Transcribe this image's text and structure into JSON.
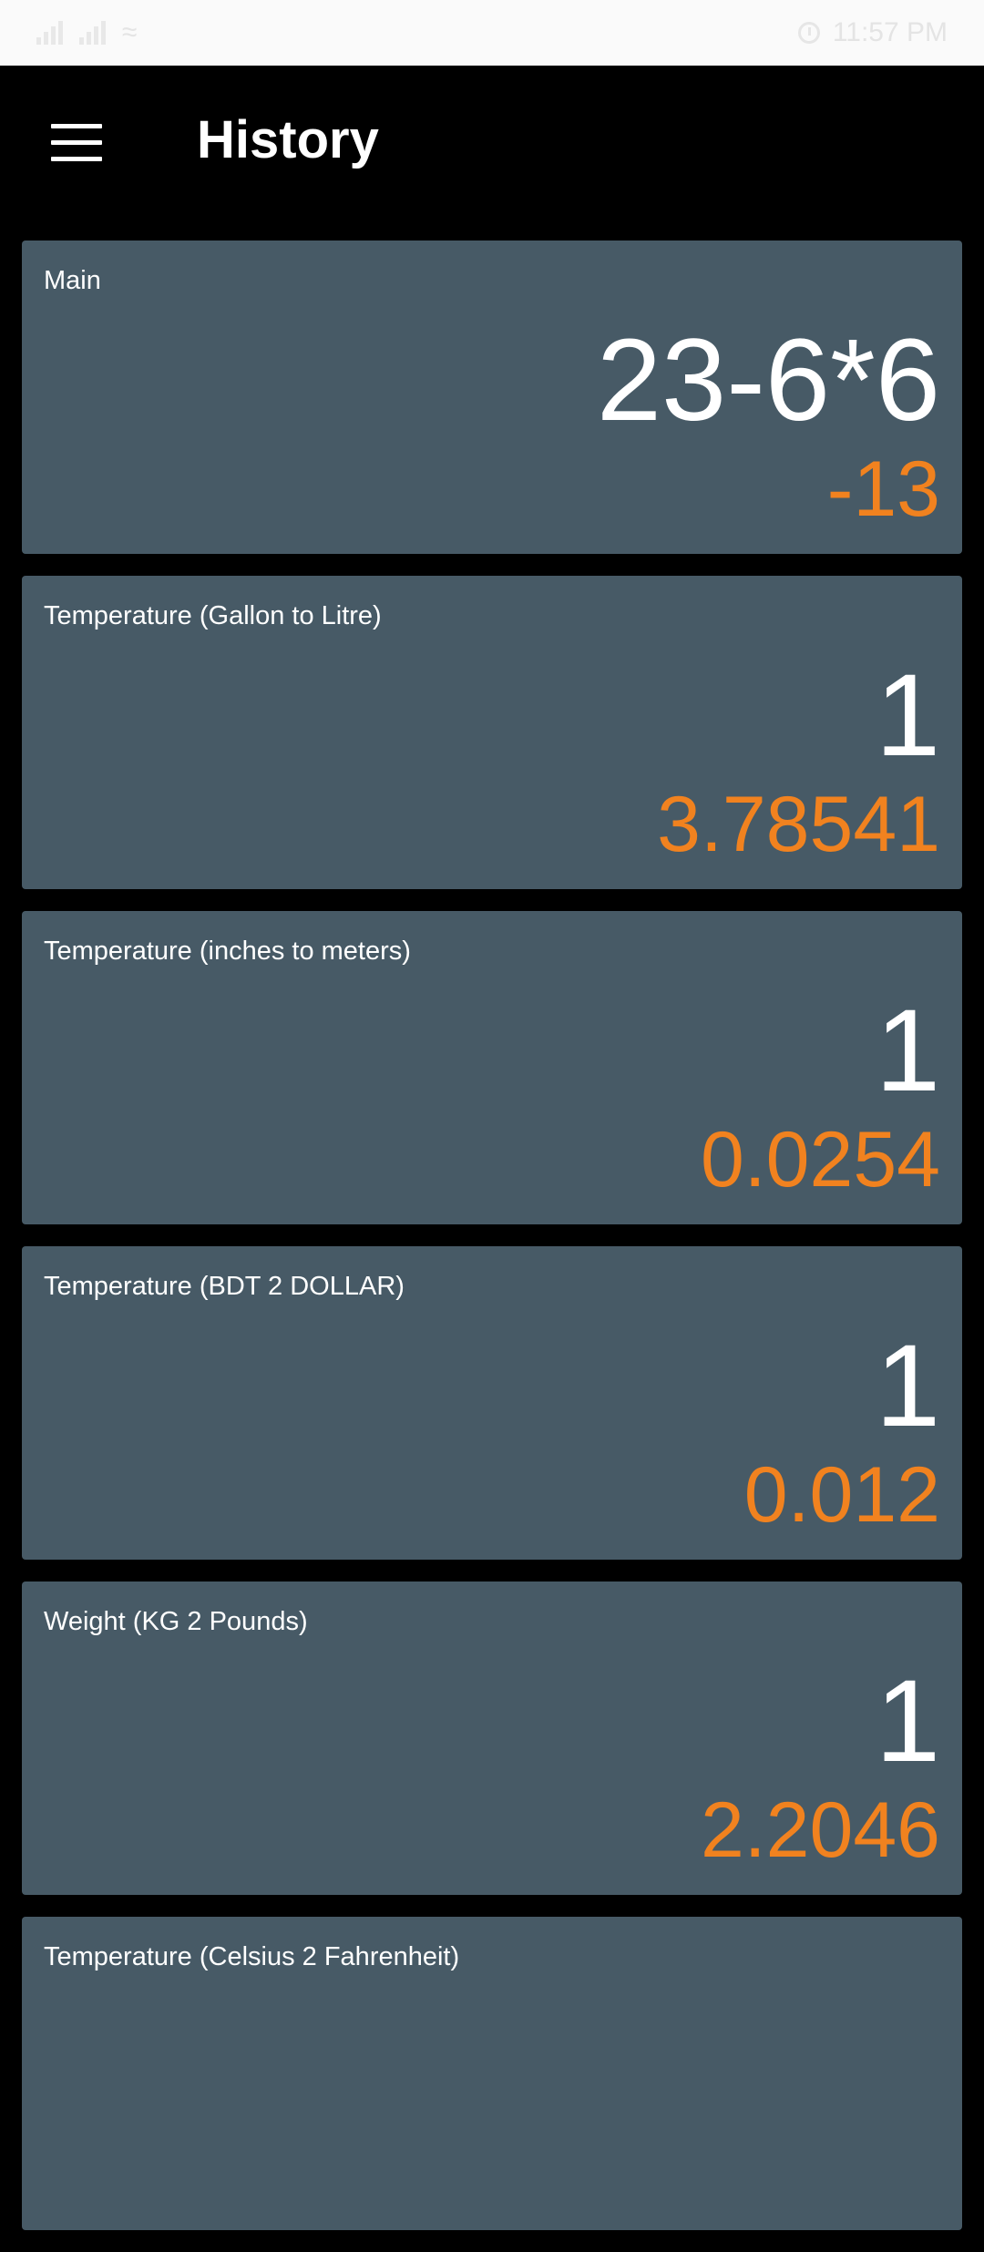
{
  "status_bar": {
    "time": "11:57 PM",
    "icons": [
      "signal-icon",
      "signal-icon",
      "wifi-icon",
      "alarm-clock-icon",
      "battery-icon"
    ]
  },
  "header": {
    "title": "History",
    "menu_icon": "hamburger-menu-icon"
  },
  "colors": {
    "card_bg": "#475a66",
    "result": "#f1821f",
    "background": "#000000"
  },
  "history": [
    {
      "label": "Main",
      "expression": "23-6*6",
      "result": "-13"
    },
    {
      "label": "Temperature (Gallon to Litre)",
      "expression": "1",
      "result": "3.78541"
    },
    {
      "label": "Temperature (inches to meters)",
      "expression": "1",
      "result": "0.0254"
    },
    {
      "label": "Temperature (BDT 2 DOLLAR)",
      "expression": "1",
      "result": "0.012"
    },
    {
      "label": "Weight (KG 2 Pounds)",
      "expression": "1",
      "result": "2.2046"
    },
    {
      "label": "Temperature (Celsius 2 Fahrenheit)",
      "expression": "",
      "result": ""
    }
  ]
}
